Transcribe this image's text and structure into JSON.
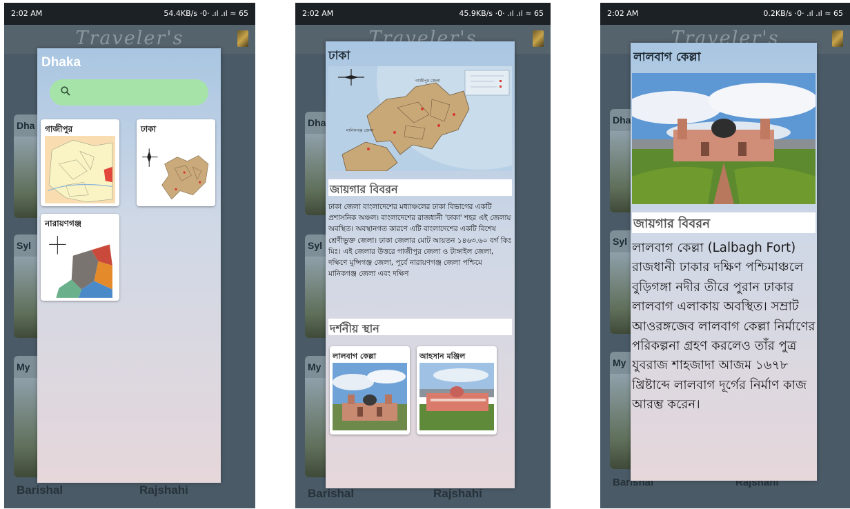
{
  "phones": [
    {
      "status_time": "2:02 AM",
      "status_right": "54.4KB/s ·0· .ıl .ıl ≈ 65",
      "app_title": "Traveler's",
      "bg_cards": [
        "Dha",
        "Syl",
        "My"
      ],
      "bg_bottom": [
        "Barishal",
        "Rajshahi"
      ],
      "dialog": {
        "title": "Dhaka",
        "districts": [
          "গাজীপুর",
          "ঢাকা",
          "নারায়ণগঞ্জ"
        ]
      }
    },
    {
      "status_time": "2:02 AM",
      "status_right": "45.9KB/s ·0· .ıl .ıl ≈ 65",
      "app_title": "Traveler's",
      "bg_cards": [
        "Dha",
        "Syl",
        "My"
      ],
      "bg_bottom": [
        "Barishal",
        "Rajshahi"
      ],
      "dialog": {
        "title": "ঢাকা",
        "desc_heading": "জায়গার বিবরন",
        "description": "ঢাকা জেলা বাংলাদেশের মধ্যাঞ্চলের ঢাকা বিভাগের একটি প্রশাসনিক অঞ্চল। বাংলাদেশের রাজধানী 'ঢাকা' শহর এই জেলায় অবস্থিত। অবস্থানগত কারণে এটি বাংলাদেশের একটি বিশেষ শ্রেণীভুক্ত জেলা। ঢাকা জেলার মোট আয়তন ১৪৬৩.৬০ বর্গ কিঃ মিঃ। এই জেলার উত্তরে গাজীপুর জেলা ও টাঙ্গাইল জেলা, দক্ষিণে মুন্সিগঞ্জ জেলা, পূর্বে নারায়ণগঞ্জ জেলা পশ্চিমে মানিকগঞ্জ জেলা এবং দক্ষিণ",
        "places_heading": "দর্শনীয় স্থান",
        "places": [
          "লালবাগ কেল্লা",
          "আহসান মঞ্জিল"
        ],
        "map_labels": [
          "গাজীপুর জেলা",
          "মানিকগঞ্জ জেলা"
        ]
      }
    },
    {
      "status_time": "2:02 AM",
      "status_right": "0.2KB/s ·0· .ıl .ıl ≈ 65",
      "app_title": "Traveler's",
      "bg_cards": [
        "Dha",
        "Syl",
        "My"
      ],
      "bg_bottom": [
        "Barishal",
        "Rajshahi"
      ],
      "dialog": {
        "title": "লালবাগ কেল্লা",
        "desc_heading": "জায়গার বিবরন",
        "description": "লালবাগ কেল্লা (Lalbagh Fort) রাজধানী ঢাকার দক্ষিণ পশ্চিমাঞ্চলে বুড়িগঙ্গা নদীর তীরে পুরান ঢাকার লালবাগ এলাকায় অবস্থিত। সম্রাট আওরঙ্গজেব লালবাগ কেল্লা নির্মাণের পরিকল্পনা গ্রহণ করলেও তাঁর পুত্র যুবরাজ শাহজাদা আজম ১৬৭৮ খ্রিষ্টাব্দে লালবাগ দূর্গের নির্মাণ কাজ আরম্ভ করেন।"
      }
    }
  ],
  "colors": {
    "search_fill": "#a6e3a9",
    "dialog_top": "#a9c6e2",
    "dialog_bottom": "#e6d7db",
    "status_bar": "#1c2126"
  },
  "icons": [
    "search-icon",
    "compass-icon"
  ]
}
